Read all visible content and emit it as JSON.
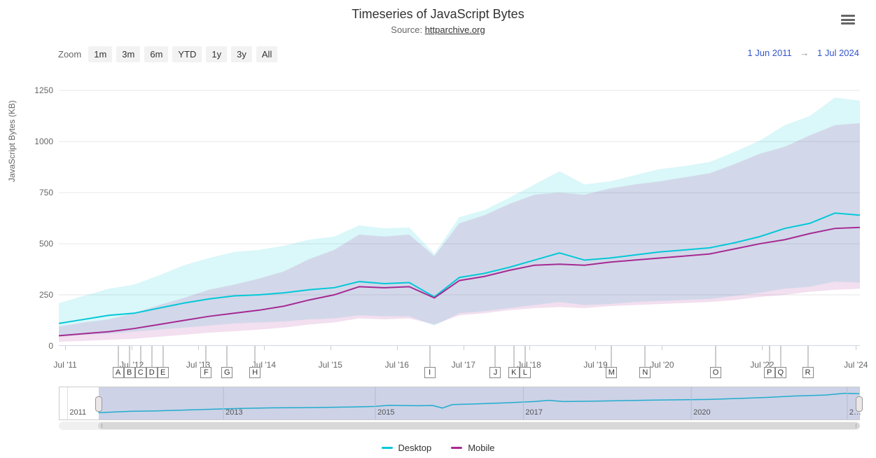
{
  "title": "Timeseries of JavaScript Bytes",
  "subtitle_prefix": "Source: ",
  "subtitle_link": "httparchive.org",
  "zoom": {
    "label": "Zoom",
    "buttons": [
      "1m",
      "3m",
      "6m",
      "YTD",
      "1y",
      "3y",
      "All"
    ]
  },
  "range": {
    "from": "1 Jun 2011",
    "to": "1 Jul 2024",
    "arrow": "→"
  },
  "y_axis": {
    "title": "JavaScript Bytes (KB)",
    "ticks": [
      0,
      250,
      500,
      750,
      1000,
      1250
    ],
    "max": 1350
  },
  "x_axis": {
    "ticks": [
      "Jul '11",
      "Jul '12",
      "Jul '13",
      "Jul '14",
      "Jul '15",
      "Jul '16",
      "Jul '17",
      "Jul '18",
      "Jul '19",
      "Jul '20",
      "Jul '22",
      "Jul '24"
    ],
    "tick_positions": [
      0.008,
      0.091,
      0.174,
      0.256,
      0.339,
      0.422,
      0.505,
      0.587,
      0.67,
      0.753,
      0.878,
      0.995
    ]
  },
  "flags": [
    {
      "label": "A",
      "pos": 0.074
    },
    {
      "label": "B",
      "pos": 0.088
    },
    {
      "label": "C",
      "pos": 0.102
    },
    {
      "label": "D",
      "pos": 0.116
    },
    {
      "label": "E",
      "pos": 0.13
    },
    {
      "label": "F",
      "pos": 0.184
    },
    {
      "label": "G",
      "pos": 0.21
    },
    {
      "label": "H",
      "pos": 0.245
    },
    {
      "label": "I",
      "pos": 0.463
    },
    {
      "label": "J",
      "pos": 0.545
    },
    {
      "label": "K",
      "pos": 0.568
    },
    {
      "label": "L",
      "pos": 0.582
    },
    {
      "label": "M",
      "pos": 0.69
    },
    {
      "label": "N",
      "pos": 0.732
    },
    {
      "label": "O",
      "pos": 0.82
    },
    {
      "label": "P",
      "pos": 0.887
    },
    {
      "label": "Q",
      "pos": 0.901
    },
    {
      "label": "R",
      "pos": 0.935
    }
  ],
  "legend": [
    {
      "name": "Desktop",
      "color": "#04c8d7"
    },
    {
      "name": "Mobile",
      "color": "#a62a92"
    }
  ],
  "navigator": {
    "labels": [
      {
        "text": "2011",
        "pos": 0.01
      },
      {
        "text": "2013",
        "pos": 0.205
      },
      {
        "text": "2015",
        "pos": 0.395
      },
      {
        "text": "2017",
        "pos": 0.58
      },
      {
        "text": "2020",
        "pos": 0.79
      },
      {
        "text": "2…",
        "pos": 0.985
      }
    ],
    "min_year": 2010.75,
    "max_year": 2024.5,
    "sel_from": 2011.42,
    "sel_to": 2024.5
  },
  "chart_data": {
    "type": "line",
    "title": "Timeseries of JavaScript Bytes",
    "xlabel": "",
    "ylabel": "JavaScript Bytes (KB)",
    "ylim": [
      0,
      1350
    ],
    "x": [
      "2011-06",
      "2011-09",
      "2012-01",
      "2012-06",
      "2012-12",
      "2013-06",
      "2013-12",
      "2014-06",
      "2014-12",
      "2015-06",
      "2015-12",
      "2016-03",
      "2016-06",
      "2016-12",
      "2017-03",
      "2017-05",
      "2017-07",
      "2017-12",
      "2018-06",
      "2018-12",
      "2019-03",
      "2019-06",
      "2019-12",
      "2020-06",
      "2020-12",
      "2021-06",
      "2021-12",
      "2022-06",
      "2022-12",
      "2023-06",
      "2023-12",
      "2024-04",
      "2024-07"
    ],
    "series": [
      {
        "name": "Desktop",
        "color": "#04c8d7",
        "values": [
          110,
          130,
          150,
          160,
          185,
          210,
          230,
          245,
          250,
          260,
          275,
          285,
          315,
          305,
          310,
          240,
          335,
          355,
          385,
          420,
          455,
          420,
          430,
          445,
          460,
          470,
          480,
          505,
          535,
          575,
          600,
          650,
          640
        ],
        "p25": [
          45,
          55,
          60,
          70,
          80,
          90,
          100,
          110,
          115,
          120,
          130,
          135,
          150,
          145,
          145,
          100,
          160,
          170,
          185,
          200,
          215,
          200,
          205,
          215,
          220,
          225,
          230,
          245,
          260,
          280,
          290,
          315,
          310
        ],
        "p75": [
          210,
          245,
          280,
          300,
          345,
          395,
          430,
          460,
          470,
          490,
          520,
          535,
          590,
          575,
          580,
          450,
          630,
          665,
          725,
          790,
          855,
          790,
          805,
          835,
          865,
          880,
          900,
          950,
          1005,
          1080,
          1125,
          1215,
          1200
        ]
      },
      {
        "name": "Mobile",
        "color": "#a62a92",
        "values": [
          50,
          60,
          70,
          85,
          105,
          125,
          145,
          160,
          175,
          195,
          225,
          250,
          290,
          285,
          290,
          235,
          320,
          340,
          370,
          395,
          400,
          395,
          410,
          420,
          430,
          440,
          450,
          475,
          500,
          520,
          550,
          575,
          580
        ],
        "p25": [
          20,
          25,
          30,
          35,
          45,
          55,
          65,
          72,
          80,
          90,
          105,
          115,
          135,
          130,
          135,
          105,
          150,
          160,
          175,
          185,
          190,
          185,
          195,
          200,
          205,
          210,
          215,
          225,
          240,
          250,
          265,
          275,
          280
        ],
        "p75": [
          95,
          115,
          130,
          160,
          200,
          235,
          275,
          300,
          330,
          365,
          425,
          470,
          545,
          535,
          545,
          440,
          600,
          640,
          695,
          740,
          750,
          740,
          770,
          790,
          805,
          825,
          845,
          890,
          940,
          975,
          1030,
          1080,
          1090
        ]
      }
    ],
    "annotations": [
      "A",
      "B",
      "C",
      "D",
      "E",
      "F",
      "G",
      "H",
      "I",
      "J",
      "K",
      "L",
      "M",
      "N",
      "O",
      "P",
      "Q",
      "R"
    ]
  }
}
